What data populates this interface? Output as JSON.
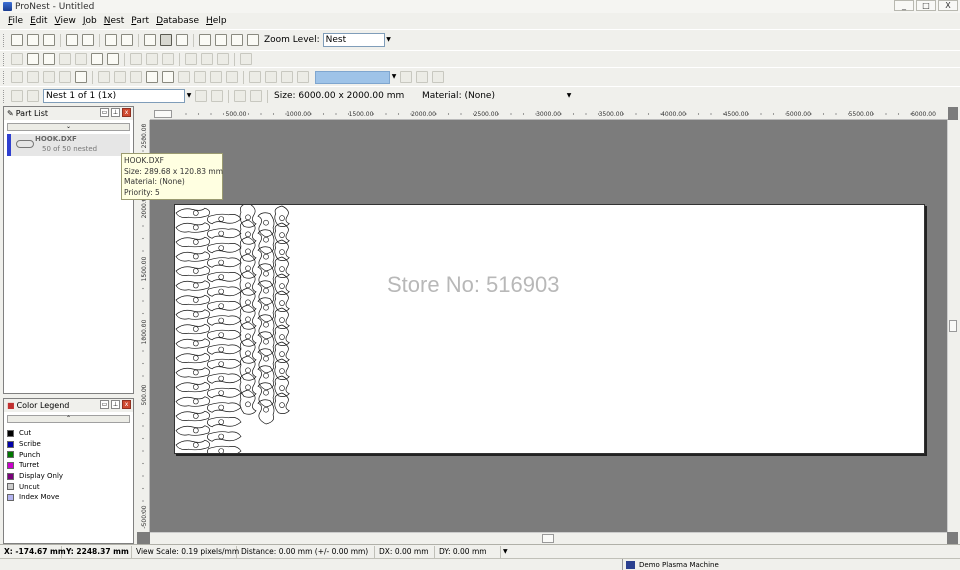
{
  "window": {
    "title": "ProNest - Untitled",
    "buttons": [
      "_",
      "□",
      "X"
    ]
  },
  "menu": [
    "File",
    "Edit",
    "View",
    "Job",
    "Nest",
    "Part",
    "Database",
    "Help"
  ],
  "toolbar1": {
    "zoom_label": "Zoom Level:",
    "zoom_value": "Nest"
  },
  "toolbar4": {
    "nest_select": "Nest 1 of 1 (1x)",
    "size": "Size: 6000.00 x 2000.00 mm",
    "material": "Material: (None)"
  },
  "part_list": {
    "title": "Part List",
    "parts": [
      {
        "name": "HOOK.DXF",
        "count": "50 of 50 nested"
      }
    ]
  },
  "tooltip": {
    "name": "HOOK.DXF",
    "size": "Size: 289.68 x 120.83 mm",
    "material": "Material: (None)",
    "priority": "Priority: 5"
  },
  "color_legend": {
    "title": "Color Legend",
    "items": [
      {
        "name": "Cut",
        "color": "#000000"
      },
      {
        "name": "Scribe",
        "color": "#0000aa"
      },
      {
        "name": "Punch",
        "color": "#007700"
      },
      {
        "name": "Turret",
        "color": "#cc00cc"
      },
      {
        "name": "Display Only",
        "color": "#7a007a"
      },
      {
        "name": "Uncut",
        "color": "#cccccc"
      },
      {
        "name": "Index Move",
        "color": "#b4b4f0"
      }
    ]
  },
  "ruler": {
    "h_labels": [
      "500.00",
      "1000.00",
      "1500.00",
      "2000.00",
      "2500.00",
      "3000.00",
      "3500.00",
      "4000.00",
      "4500.00",
      "5000.00",
      "5500.00",
      "6000.00"
    ],
    "v_labels": [
      "2500.00",
      "2000.00",
      "1500.00",
      "1000.00",
      "500.00",
      "-500.00"
    ]
  },
  "watermark": "Store No: 516903",
  "status": {
    "x": "X: -174.67 mm",
    "y": "Y: 2248.37 mm",
    "scale": "View Scale: 0.19 pixels/mm",
    "distance": "Distance: 0.00 mm (+/- 0.00 mm)",
    "dx": "DX: 0.00 mm",
    "dy": "DY: 0.00 mm"
  },
  "taskbar": {
    "machine": "Demo Plasma Machine"
  }
}
